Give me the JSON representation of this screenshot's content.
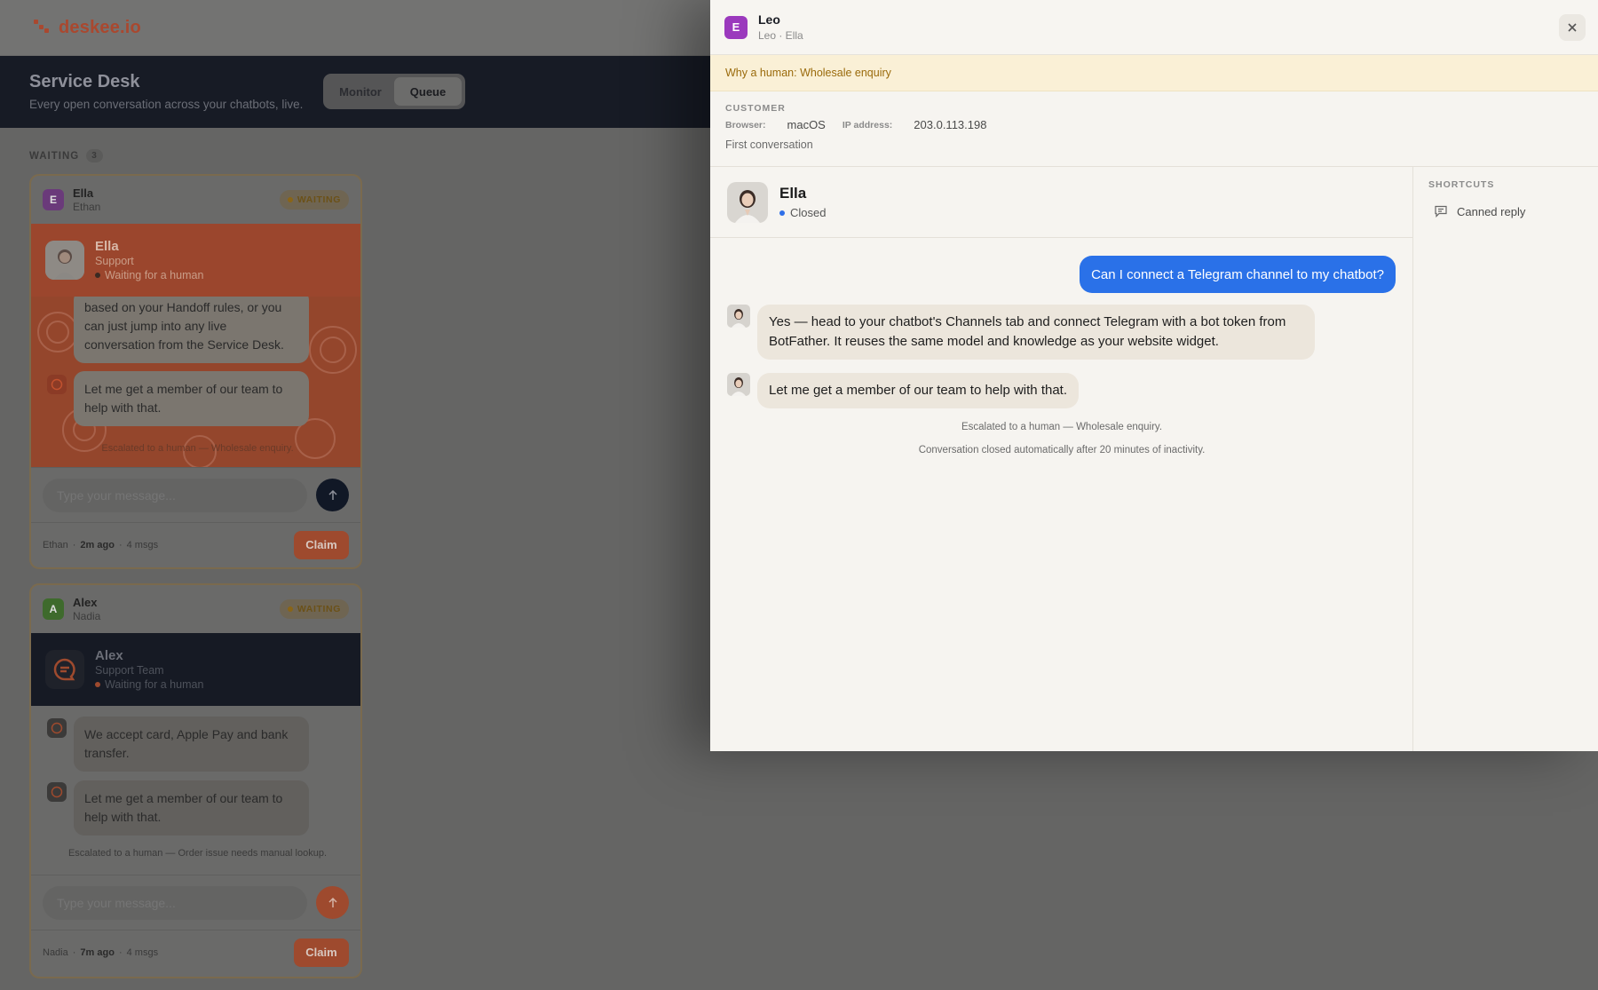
{
  "app": {
    "brand": "deskee.io"
  },
  "header": {
    "title": "Service Desk",
    "subtitle": "Every open conversation across your chatbots, live.",
    "tabs": [
      {
        "label": "Monitor",
        "active": false
      },
      {
        "label": "Queue",
        "active": true
      }
    ]
  },
  "queue": {
    "section_label": "WAITING",
    "count": "3"
  },
  "cards": [
    {
      "initial": "E",
      "initial_color": "#6a3a7a",
      "name": "Ella",
      "agent": "Ethan",
      "badge": "WAITING",
      "widget": {
        "name": "Ella",
        "role": "Support",
        "status": "Waiting for a human",
        "theme": "#9b462d"
      },
      "messages": [
        "based on your Handoff rules, or you can just jump into any live conversation from the Service Desk.",
        "Let me get a member of our team to help with that."
      ],
      "system": "Escalated to a human — Wholesale enquiry.",
      "input_placeholder": "Type your message...",
      "footer": {
        "agent": "Ethan",
        "time": "2m ago",
        "msgs": "4 msgs",
        "claim": "Claim"
      }
    },
    {
      "initial": "A",
      "initial_color": "#3e6a2c",
      "name": "Alex",
      "agent": "Nadia",
      "badge": "WAITING",
      "widget": {
        "name": "Alex",
        "role": "Support Team",
        "status": "Waiting for a human",
        "theme": "#161a24"
      },
      "messages": [
        "We accept card, Apple Pay and bank transfer.",
        "Let me get a member of our team to help with that."
      ],
      "system": "Escalated to a human — Order issue needs manual lookup.",
      "input_placeholder": "Type your message...",
      "footer": {
        "agent": "Nadia",
        "time": "7m ago",
        "msgs": "4 msgs",
        "claim": "Claim"
      }
    }
  ],
  "drawer": {
    "initial": "E",
    "title": "Leo",
    "subtitle": "Leo · Ella",
    "close_icon": "close-icon",
    "reason": "Why a human: Wholesale enquiry",
    "customer": {
      "label": "CUSTOMER",
      "browser_label": "Browser:",
      "browser": "macOS",
      "ip_label": "IP address:",
      "ip": "203.0.113.198",
      "first": "First conversation"
    },
    "chat": {
      "name": "Ella",
      "status": "Closed",
      "status_color": "#2f6fe8",
      "user_message": "Can I connect a Telegram channel to my chatbot?",
      "bot_messages": [
        "Yes — head to your chatbot's Channels tab and connect Telegram with a bot token from BotFather. It reuses the same model and knowledge as your website widget.",
        "Let me get a member of our team to help with that."
      ],
      "system": [
        "Escalated to a human — Wholesale enquiry.",
        "Conversation closed automatically after 20 minutes of inactivity."
      ]
    },
    "shortcuts": {
      "label": "SHORTCUTS",
      "items": [
        {
          "label": "Canned reply",
          "icon": "message-icon"
        }
      ]
    }
  },
  "colors": {
    "accent": "#2a71e8",
    "brand": "#c2522f",
    "reason_bg": "#faf0d6",
    "reason_text": "#9a6a0b"
  }
}
